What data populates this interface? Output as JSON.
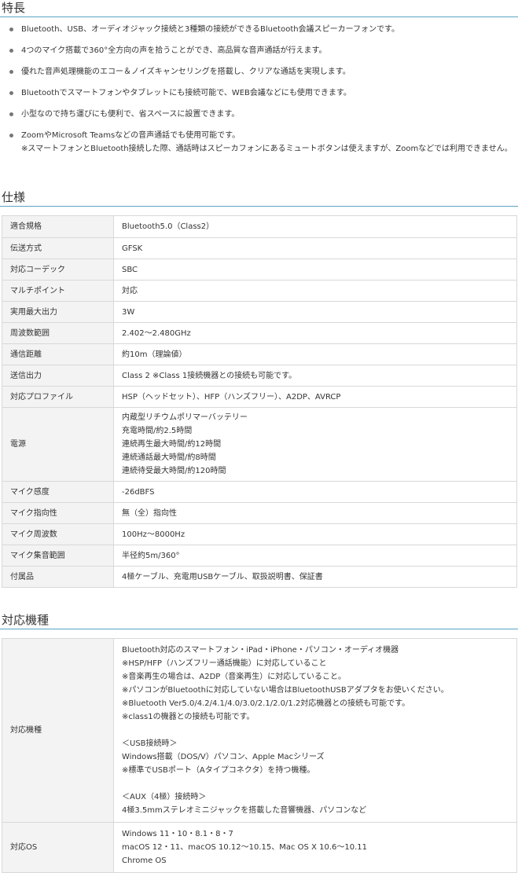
{
  "features": {
    "title": "特長",
    "items": [
      [
        "Bluetooth、USB、オーディオジャック接続と3種類の接続ができるBluetooth会議スピーカーフォンです。"
      ],
      [
        "4つのマイク搭載で360°全方向の声を拾うことができ、高品質な音声通話が行えます。"
      ],
      [
        "優れた音声処理機能のエコー＆ノイズキャンセリングを搭載し、クリアな通話を実現します。"
      ],
      [
        "Bluetoothでスマートフォンやタブレットにも接続可能で、WEB会議などにも使用できます。"
      ],
      [
        "小型なので持ち運びにも便利で、省スペースに設置できます。"
      ],
      [
        "ZoomやMicrosoft Teamsなどの音声通話でも使用可能です。",
        "※スマートフォンとBluetooth接続した際、通話時はスピーカフォンにあるミュートボタンは使えますが、Zoomなどでは利用できません。"
      ]
    ]
  },
  "specs": {
    "title": "仕様",
    "rows": [
      {
        "label": "適合規格",
        "lines": [
          "Bluetooth5.0（Class2）"
        ]
      },
      {
        "label": "伝送方式",
        "lines": [
          "GFSK"
        ]
      },
      {
        "label": "対応コーデック",
        "lines": [
          "SBC"
        ]
      },
      {
        "label": "マルチポイント",
        "lines": [
          "対応"
        ]
      },
      {
        "label": "実用最大出力",
        "lines": [
          "3W"
        ]
      },
      {
        "label": "周波数範囲",
        "lines": [
          "2.402～2.480GHz"
        ]
      },
      {
        "label": "通信距離",
        "lines": [
          "約10m（理論値）"
        ]
      },
      {
        "label": "送信出力",
        "lines": [
          "Class 2 ※Class 1接続機器との接続も可能です。"
        ]
      },
      {
        "label": "対応プロファイル",
        "lines": [
          "HSP（ヘッドセット）、HFP（ハンズフリー）、A2DP、AVRCP"
        ]
      },
      {
        "label": "電源",
        "lines": [
          "内蔵型リチウムポリマーバッテリー",
          "充電時間/約2.5時間",
          "連続再生最大時間/約12時間",
          "連続通話最大時間/約8時間",
          "連続待受最大時間/約120時間"
        ]
      },
      {
        "label": "マイク感度",
        "lines": [
          "-26dBFS"
        ]
      },
      {
        "label": "マイク指向性",
        "lines": [
          "無（全）指向性"
        ]
      },
      {
        "label": "マイク周波数",
        "lines": [
          "100Hz～8000Hz"
        ]
      },
      {
        "label": "マイク集音範囲",
        "lines": [
          "半径約5m/360°"
        ]
      },
      {
        "label": "付属品",
        "lines": [
          "4極ケーブル、充電用USBケーブル、取扱説明書、保証書"
        ]
      }
    ]
  },
  "compat": {
    "title": "対応機種",
    "rows": [
      {
        "label": "対応機種",
        "lines": [
          "Bluetooth対応のスマートフォン・iPad・iPhone・パソコン・オーディオ機器",
          "※HSP/HFP（ハンズフリー通話機能）に対応していること",
          "※音楽再生の場合は、A2DP（音楽再生）に対応していること。",
          "※パソコンがBluetoothに対応していない場合はBluetoothUSBアダプタをお使いください。",
          "※Bluetooth Ver5.0/4.2/4.1/4.0/3.0/2.1/2.0/1.2対応機器との接続も可能です。",
          "※class1の機器との接続も可能です。",
          "",
          "＜USB接続時＞",
          "Windows搭載（DOS/V）パソコン、Apple Macシリーズ",
          "※標準でUSBポート（Aタイプコネクタ）を持つ機種。",
          "",
          "＜AUX（4極）接続時＞",
          "4極3.5mmステレオミニジャックを搭載した音響機器、パソコンなど"
        ]
      },
      {
        "label": "対応OS",
        "lines": [
          "Windows 11・10・8.1・8・7",
          "macOS 12・11、macOS 10.12～10.15、Mac OS X 10.6～10.11",
          "Chrome OS"
        ]
      }
    ]
  }
}
